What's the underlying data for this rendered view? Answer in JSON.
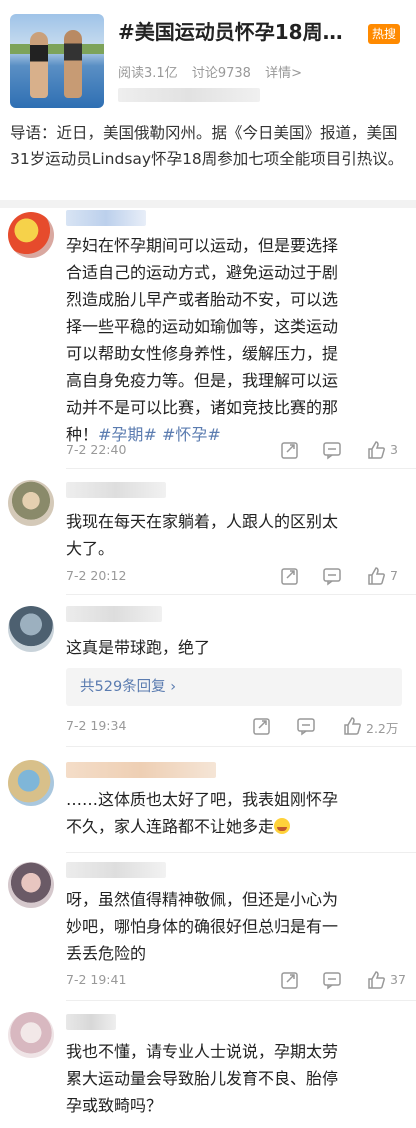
{
  "topic": {
    "title": "#美国运动员怀孕18周…",
    "hot_badge": "热搜",
    "read_count": "阅读3.1亿",
    "discussion_count": "讨论9738",
    "details_link": "详情>"
  },
  "intro": "导语：近日，美国俄勒冈州。据《今日美国》报道，美国31岁运动员Lindsay怀孕18周参加七项全能项目引热议。",
  "comments": [
    {
      "text_lines": [
        "孕妇在怀孕期间可以运动，但是要选择",
        "合适自己的运动方式，避免运动过于剧",
        "烈造成胎儿早产或者胎动不安，可以选",
        "择一些平稳的运动如瑜伽等，这类运动",
        "可以帮助女性修身养性，缓解压力，提",
        "高自身免疫力等。但是，我理解可以运",
        "动并不是可以比赛，诸如竞技比赛的那",
        "种！"
      ],
      "hashtags": [
        "#孕期#",
        "#怀孕#"
      ],
      "time": "7-2 22:40",
      "likes": "3"
    },
    {
      "text_lines": [
        "我现在每天在家躺着，人跟人的区别太",
        "大了。"
      ],
      "time": "7-2 20:12",
      "likes": "7"
    },
    {
      "text_lines": [
        "这真是带球跑，绝了"
      ],
      "replies_label": "共529条回复",
      "replies_chevron": "›",
      "time": "7-2 19:34",
      "likes": "2.2万"
    },
    {
      "text_lines": [
        "……这体质也太好了吧，我表姐刚怀孕",
        "不久，家人连路都不让她多走"
      ]
    },
    {
      "text_lines": [
        "呀，虽然值得精神敬佩，但还是小心为",
        "妙吧，哪怕身体的确很好但总归是有一",
        "丢丢危险的"
      ],
      "time": "7-2 19:41",
      "likes": "37"
    },
    {
      "text_lines": [
        "我也不懂，请专业人士说说，孕期太劳",
        "累大运动量会导致胎儿发育不良、胎停",
        "孕或致畸吗？"
      ]
    }
  ],
  "icons": {
    "forward": "share-forward-icon",
    "comment": "comment-icon",
    "like": "thumbs-up-icon",
    "emoji": "laughing-emoji-icon"
  },
  "colors": {
    "hot_badge": "#ff8a00",
    "link_blue": "#5b7cb0",
    "meta_gray": "#999999"
  }
}
